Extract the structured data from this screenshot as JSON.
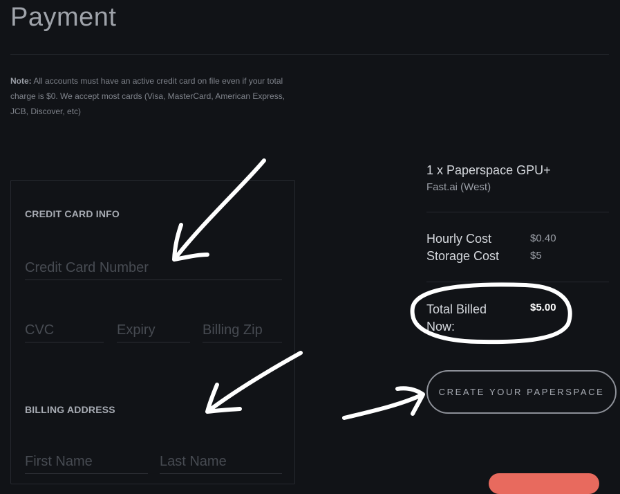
{
  "page": {
    "title": "Payment",
    "note_label": "Note:",
    "note_text": " All accounts must have an active credit card on file even if your total charge is $0. We accept most cards (Visa, MasterCard, American Express, JCB, Discover, etc)"
  },
  "credit_card": {
    "heading": "CREDIT CARD INFO",
    "number_placeholder": "Credit Card Number",
    "cvc_placeholder": "CVC",
    "expiry_placeholder": "Expiry",
    "zip_placeholder": "Billing Zip"
  },
  "billing": {
    "heading": "BILLING ADDRESS",
    "first_name_placeholder": "First Name",
    "last_name_placeholder": "Last Name"
  },
  "summary": {
    "product": "1 x Paperspace GPU+",
    "location": "Fast.ai (West)",
    "hourly_label": "Hourly Cost",
    "hourly_value": "$0.40",
    "storage_label": "Storage Cost",
    "storage_value": "$5",
    "total_label": "Total Billed Now:",
    "total_value": "$5.00"
  },
  "actions": {
    "create_label": "CREATE YOUR PAPERSPACE"
  },
  "colors": {
    "background": "#111317",
    "accent_button": "#e86a5e",
    "annotation": "#ffffff"
  }
}
